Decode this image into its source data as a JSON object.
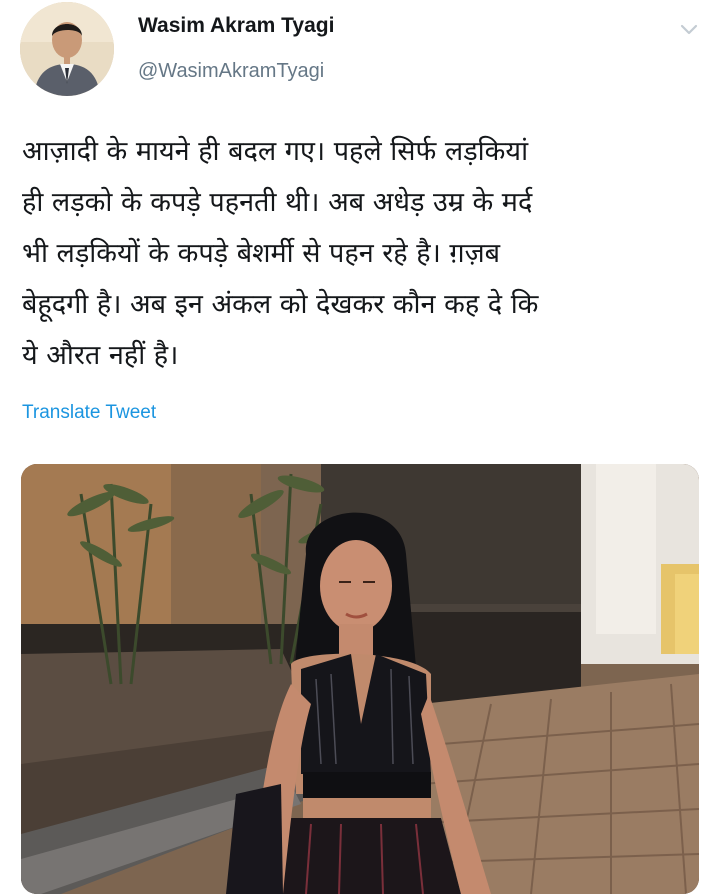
{
  "tweet": {
    "display_name": "Wasim Akram Tyagi",
    "handle": "@WasimAkramTyagi",
    "text_lines": [
      "आज़ादी के मायने ही बदल गए। पहले सिर्फ लड़कियां",
      "ही लड़को के कपड़े पहनती थी। अब अधेड़ उम्र के मर्द",
      "भी लड़कियों के कपड़े बेशर्मी से पहन रहे है। ग़ज़ब",
      "बेहूदगी है। अब इन अंकल को देखकर कौन कह दे कि",
      "ये औरत नहीं है।"
    ],
    "translate_label": "Translate Tweet"
  },
  "icons": {
    "menu": "chevron-down-icon",
    "avatar": "avatar"
  },
  "colors": {
    "text": "#14171a",
    "secondary": "#657786",
    "link": "#1b95e0"
  }
}
